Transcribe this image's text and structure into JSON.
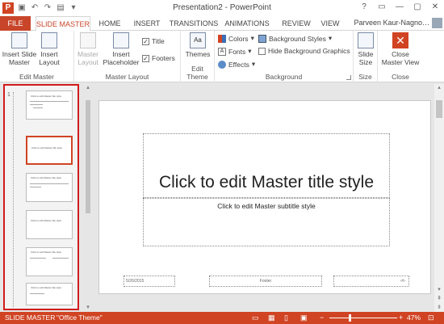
{
  "window": {
    "title": "Presentation2 - PowerPoint",
    "controls": [
      "?",
      "▭",
      "—",
      "▢",
      "✕"
    ]
  },
  "tabs": [
    "FILE",
    "SLIDE MASTER",
    "HOME",
    "INSERT",
    "TRANSITIONS",
    "ANIMATIONS",
    "REVIEW",
    "VIEW"
  ],
  "user": "Parveen Kaur-Nagno…",
  "ribbon": {
    "edit_master": {
      "label": "Edit Master",
      "insert_slide_master": "Insert Slide Master",
      "insert_layout": "Insert Layout"
    },
    "master_layout": {
      "label": "Master Layout",
      "master_layout_btn": "Master Layout",
      "insert_placeholder": "Insert Placeholder",
      "title_check": "Title",
      "footers_check": "Footers"
    },
    "edit_theme": {
      "label": "Edit Theme",
      "themes": "Themes"
    },
    "background": {
      "label": "Background",
      "colors": "Colors",
      "fonts": "Fonts",
      "effects": "Effects",
      "background_styles": "Background Styles",
      "hide_background": "Hide Background Graphics"
    },
    "size": {
      "label": "Size",
      "slide_size": "Slide Size"
    },
    "close": {
      "label": "Close",
      "close_master_view": "Close Master View"
    }
  },
  "slide": {
    "title": "Click to edit Master title style",
    "subtitle": "Click to edit Master subtitle style",
    "date": "5/26/2015",
    "footer": "Footer",
    "number": "‹#›"
  },
  "thumbnails": {
    "number": "1",
    "thumb_title": "Click to edit Master title style"
  },
  "status": {
    "view": "SLIDE MASTER",
    "theme": "\"Office Theme\"",
    "zoom": "47%"
  },
  "colors": {
    "accent": "#d04423",
    "highlight": "#d21b1b"
  }
}
